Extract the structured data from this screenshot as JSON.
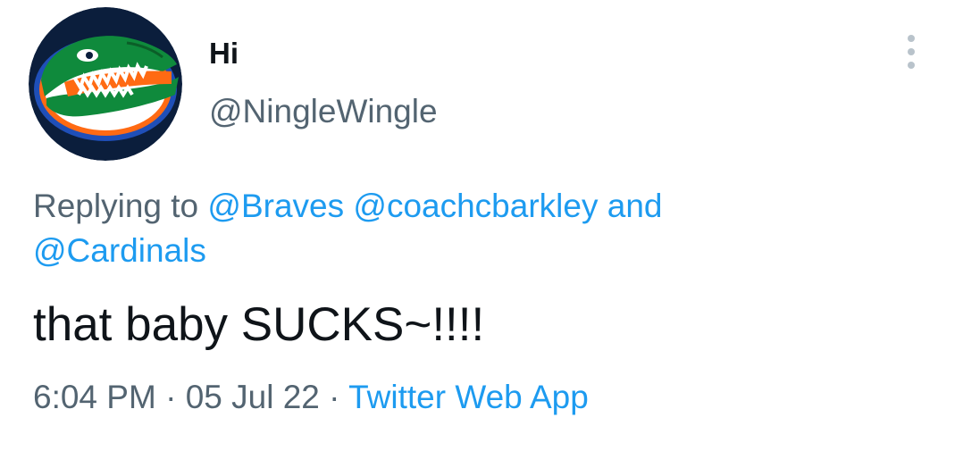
{
  "user": {
    "display_name": "Hi",
    "handle": "@NingleWingle",
    "avatar_icon": "florida-gator-logo-icon"
  },
  "menu": {
    "icon": "more-vertical-icon"
  },
  "reply_context": {
    "prefix": "Replying to",
    "mentions": [
      "@Braves",
      "@coachcbarkley",
      "@Cardinals"
    ],
    "conjunction": "and"
  },
  "tweet": {
    "text": "that baby SUCKS~!!!!"
  },
  "meta": {
    "time": "6:04 PM",
    "separator": "·",
    "date": "05 Jul 22",
    "source": "Twitter Web App"
  },
  "colors": {
    "link": "#1d9bf0",
    "secondary_text": "#536471",
    "primary_text": "#0f1419"
  }
}
